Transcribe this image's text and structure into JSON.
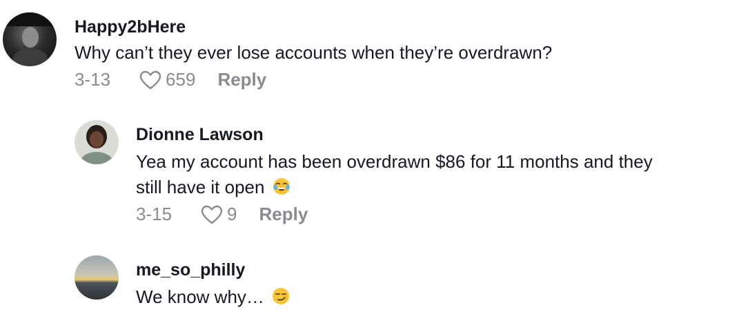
{
  "comments": [
    {
      "username": "Happy2bHere",
      "text": "Why can’t they ever lose accounts when they’re overdrawn?",
      "date": "3-13",
      "likes": "659",
      "reply_label": "Reply"
    },
    {
      "username": "Dionne Lawson",
      "text_line1": "Yea my account has been overdrawn $86 for 11 months and they",
      "text_line2": "still have it open",
      "date": "3-15",
      "likes": "9",
      "reply_label": "Reply"
    },
    {
      "username": "me_so_philly",
      "text": "We know why…"
    }
  ],
  "icons": {
    "like": "heart-outline-icon",
    "laugh": "face-with-tears-of-joy-emoji",
    "smirk": "smirking-face-emoji"
  },
  "colors": {
    "text": "#161823",
    "muted": "#8a8b91"
  }
}
